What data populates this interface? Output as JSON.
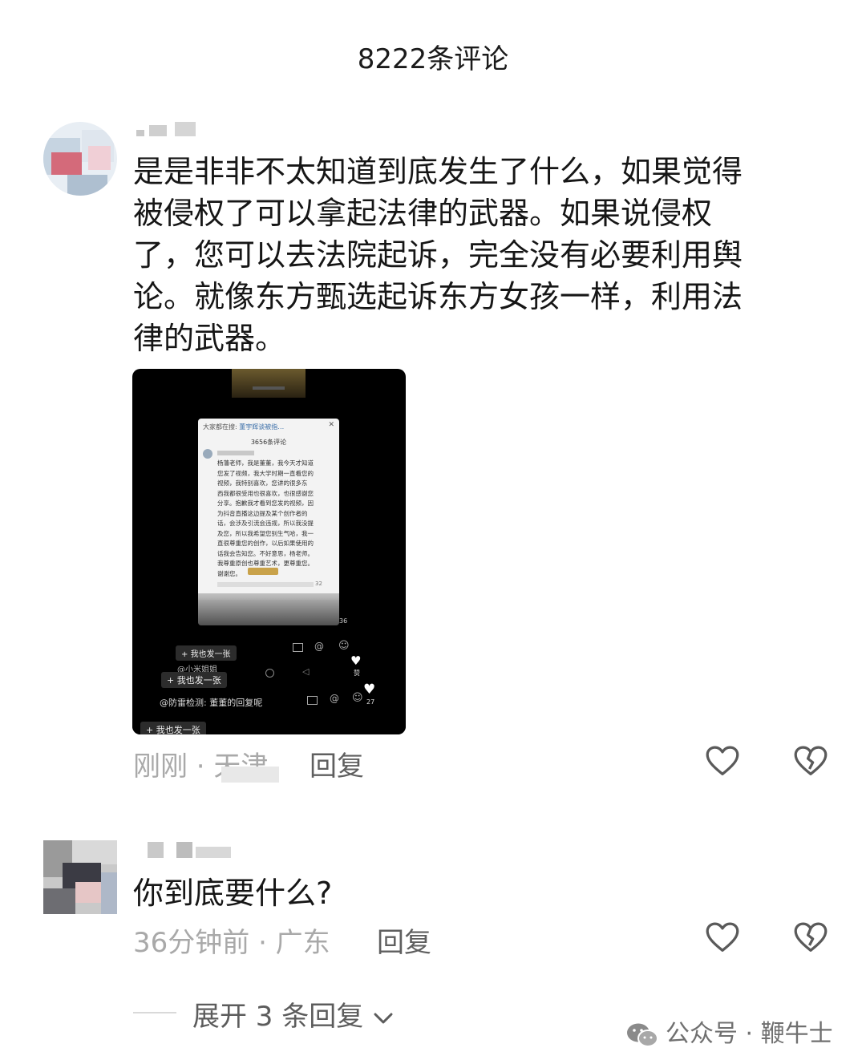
{
  "header": {
    "title": "8222条评论"
  },
  "comments": [
    {
      "text_lines": [
        "是是非非不太知道到底发生了什么，如果觉得",
        "被侵权了可以拿起法律的武器。如果说侵权",
        "了，您可以去法院起诉，完全没有必要利用舆",
        "论。就像东方甄选起诉东方女孩一样，利用法",
        "律的武器。"
      ],
      "meta": "刚刚 · 天津",
      "reply_label": "回复",
      "image": {
        "inner_count": "3656条评论",
        "search_prefix": "大家都在搜:",
        "search_term": "董宇辉谈被指…",
        "body_lines": [
          "杨藩老师，我是董董，我今天才知道",
          "您发了视频，我大学时期一直看您的",
          "视频，我特别喜欢，您讲的很多东",
          "西我都很受用也很喜欢，也很感谢您",
          "分享。抱歉我才看到您发的视频，因",
          "为抖音直播这边提及某个创作者的",
          "话，会涉及引流会违规，所以我没提",
          "及您，所以我希望您别生气哈，我一",
          "直很尊重您的创作，以后如果使用的",
          "话我会告知您。不好意思，杨老师。",
          "我尊重原创也尊重艺术，更尊重您。",
          "谢谢您。"
        ],
        "like_count": "32",
        "side_like_1": "36",
        "side_like_2": "赞",
        "side_like_3": "27",
        "btn_label": "我也发一张",
        "btn_label_2": "我也发一张",
        "btn_label_3": "我也发一张",
        "line_a": "@小米姐姐",
        "line_b": "@防雷检测: 董董的回复呢"
      }
    },
    {
      "text_lines": [
        "你到底要什么?"
      ],
      "meta": "36分钟前 · 广东",
      "reply_label": "回复"
    }
  ],
  "expand_label": "展开 3 条回复",
  "watermark": "公众号 · 鞭牛士"
}
